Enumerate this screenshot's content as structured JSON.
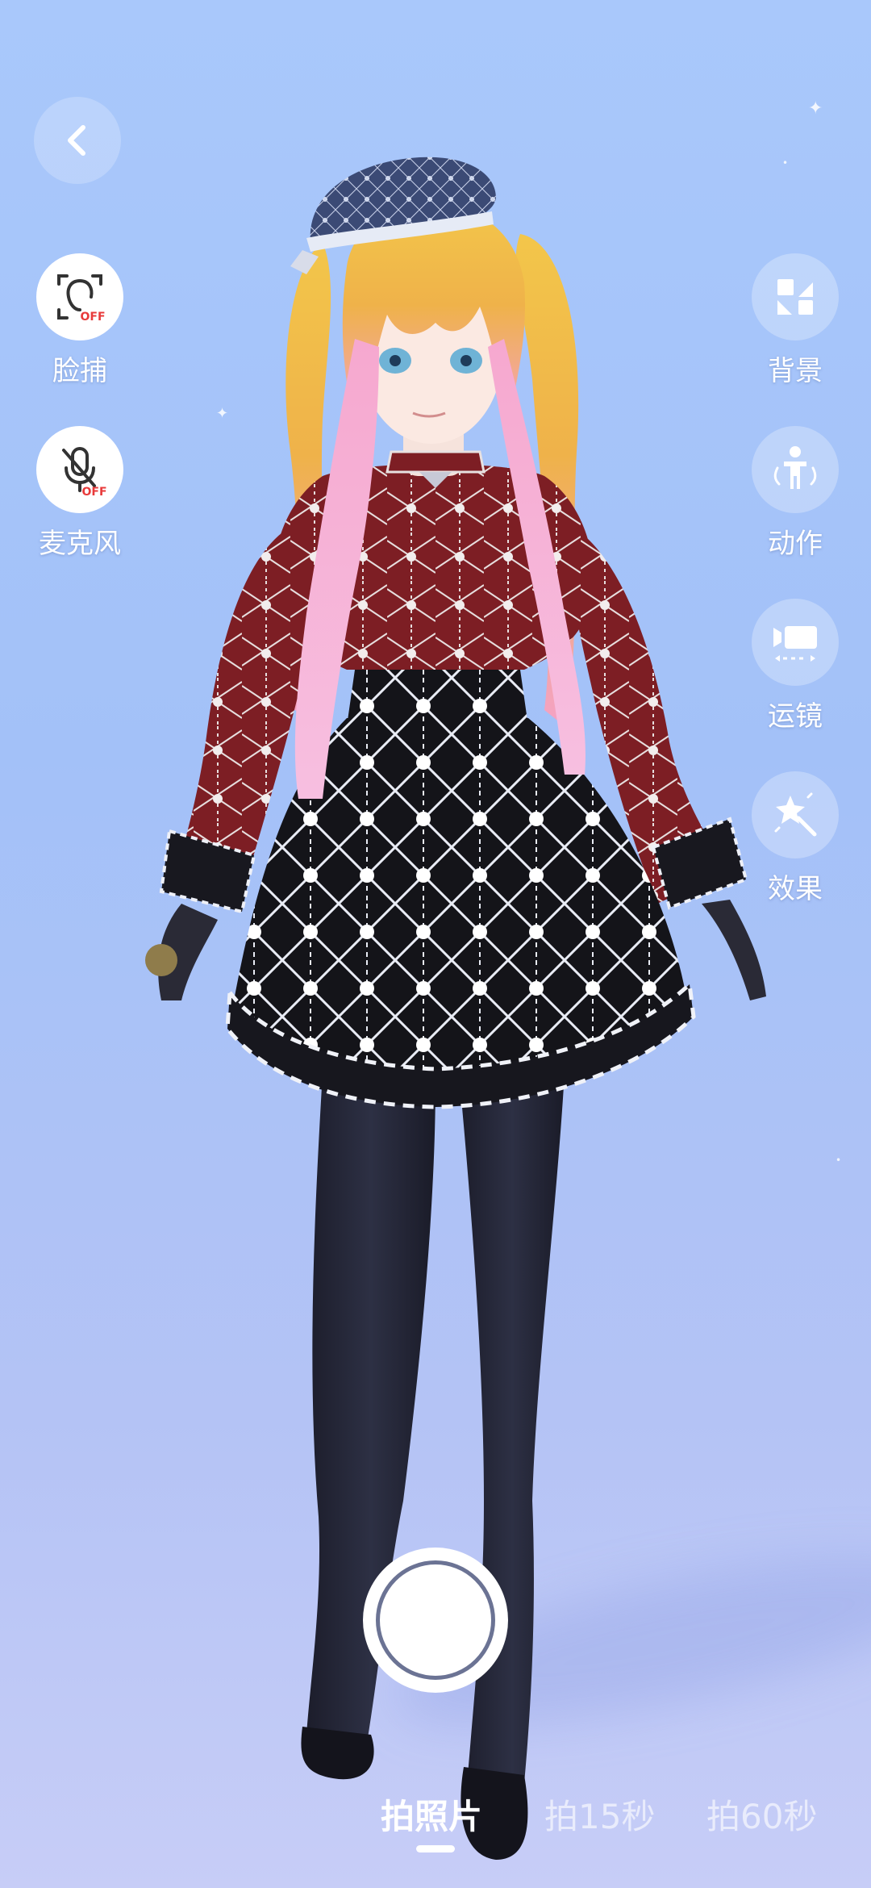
{
  "navigation": {
    "back_icon": "chevron-left-icon"
  },
  "left_tools": [
    {
      "label": "脸捕",
      "icon": "face-capture-icon",
      "status": "OFF"
    },
    {
      "label": "麦克风",
      "icon": "microphone-muted-icon",
      "status": "OFF"
    }
  ],
  "right_tools": [
    {
      "label": "背景",
      "icon": "background-grid-icon"
    },
    {
      "label": "动作",
      "icon": "person-action-icon"
    },
    {
      "label": "运镜",
      "icon": "camera-move-icon"
    },
    {
      "label": "效果",
      "icon": "magic-wand-icon"
    }
  ],
  "capture": {
    "shutter_icon": "shutter-button-icon",
    "modes": [
      {
        "label": "拍照片",
        "active": true
      },
      {
        "label": "拍15秒",
        "active": false
      },
      {
        "label": "拍60秒",
        "active": false
      }
    ]
  },
  "colors": {
    "background": "#a9c8fb",
    "status_off": "#e83a3a",
    "label": "#ffffff"
  }
}
